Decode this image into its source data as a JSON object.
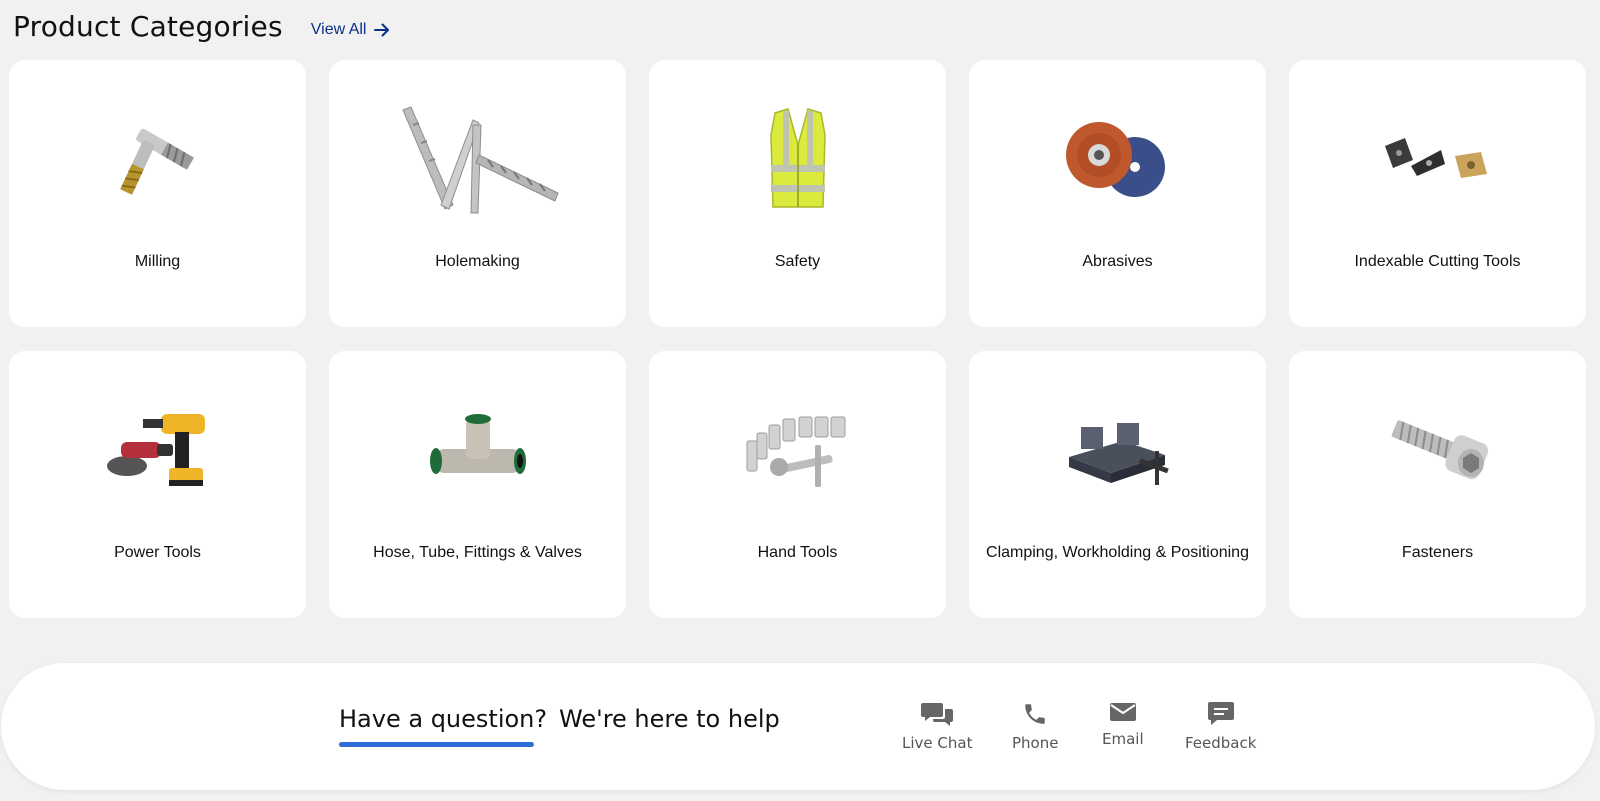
{
  "header": {
    "title": "Product Categories",
    "view_all": "View All"
  },
  "categories": [
    {
      "label": "Milling",
      "icon": "end-mill-image"
    },
    {
      "label": "Holemaking",
      "icon": "drill-bits-image"
    },
    {
      "label": "Safety",
      "icon": "safety-vest-image"
    },
    {
      "label": "Abrasives",
      "icon": "flap-discs-image"
    },
    {
      "label": "Indexable Cutting Tools",
      "icon": "carbide-inserts-image"
    },
    {
      "label": "Power Tools",
      "icon": "power-tools-image"
    },
    {
      "label": "Hose, Tube, Fittings & Valves",
      "icon": "tee-fitting-image"
    },
    {
      "label": "Hand Tools",
      "icon": "socket-set-image"
    },
    {
      "label": "Clamping, Workholding & Positioning",
      "icon": "vise-image"
    },
    {
      "label": "Fasteners",
      "icon": "socket-cap-screw-image"
    }
  ],
  "help": {
    "tab_question": "Have a question?",
    "tab_help": "We're here to help",
    "contacts": [
      {
        "label": "Live Chat",
        "icon": "chat-icon"
      },
      {
        "label": "Phone",
        "icon": "phone-icon"
      },
      {
        "label": "Email",
        "icon": "email-icon"
      },
      {
        "label": "Feedback",
        "icon": "feedback-icon"
      }
    ]
  },
  "colors": {
    "link": "#0b2f8a",
    "accent": "#2f6bd8",
    "background": "#f1f1f1",
    "contact_icon": "#666666"
  }
}
